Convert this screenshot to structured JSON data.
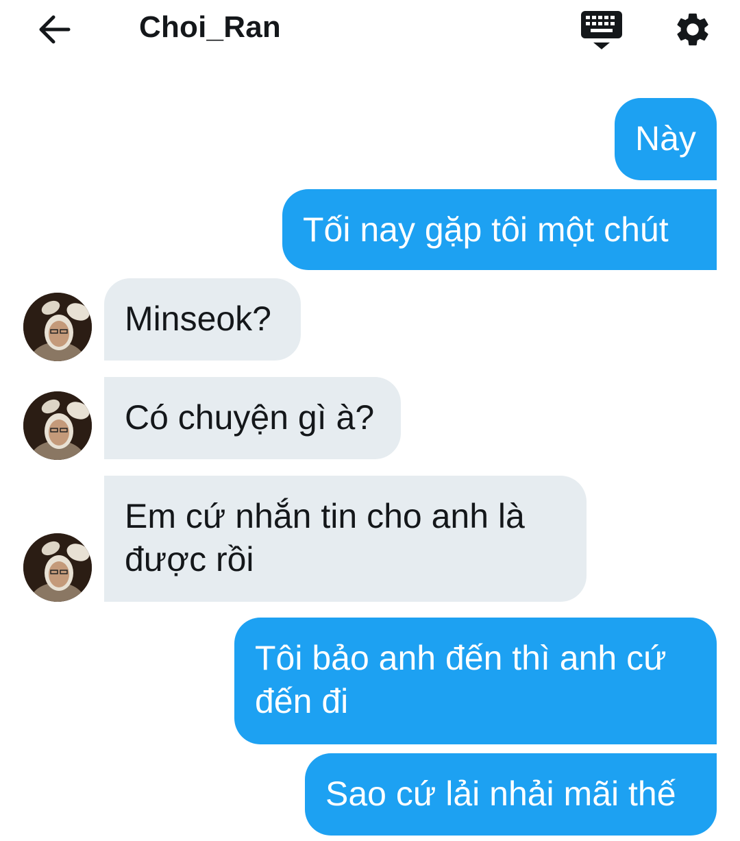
{
  "header": {
    "title": "Choi_Ran",
    "back_icon": "arrow-left-icon",
    "keyboard_icon": "keyboard-hide-icon",
    "settings_icon": "gear-icon"
  },
  "colors": {
    "outgoing_bubble": "#1da1f2",
    "incoming_bubble": "#e6ecf0",
    "text_dark": "#14171a"
  },
  "messages": [
    {
      "direction": "out",
      "text": "Này"
    },
    {
      "direction": "out",
      "text": "Tối nay gặp tôi một chút"
    },
    {
      "direction": "in",
      "text": "Minseok?",
      "avatar": "user-avatar"
    },
    {
      "direction": "in",
      "text": "Có chuyện gì à?",
      "avatar": "user-avatar"
    },
    {
      "direction": "in",
      "lines": [
        "Em cứ nhắn tin cho anh là",
        "được rồi"
      ],
      "avatar": "user-avatar"
    },
    {
      "direction": "out",
      "lines": [
        "Tôi bảo anh đến thì anh cứ",
        "đến đi"
      ]
    },
    {
      "direction": "out",
      "text": "Sao cứ lải nhải mãi thế"
    }
  ]
}
